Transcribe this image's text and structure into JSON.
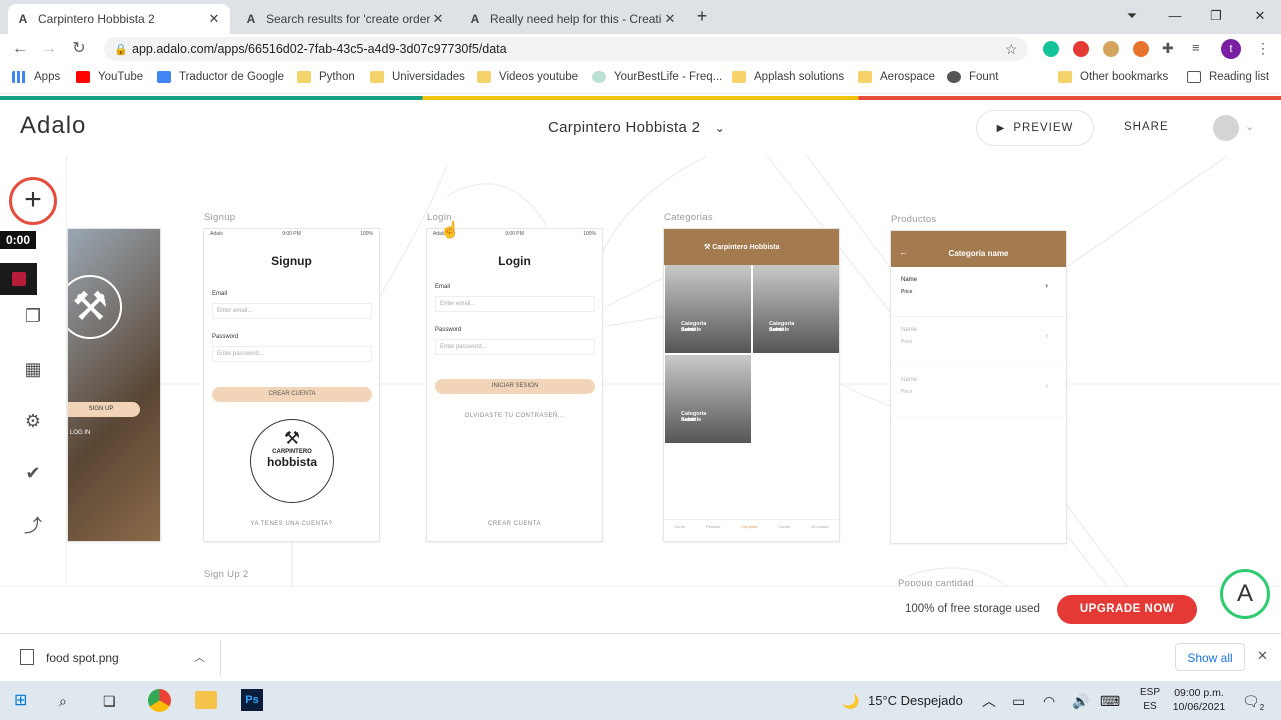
{
  "tabs": [
    {
      "title": "Carpintero Hobbista 2",
      "active": true
    },
    {
      "title": "Search results for 'create order c",
      "active": false
    },
    {
      "title": "Really need help for this - Creatir",
      "active": false
    }
  ],
  "address": {
    "url": "app.adalo.com/apps/66516d02-7fab-43c5-a4d9-3d07c97730f5/data"
  },
  "bookmarks": [
    "Apps",
    "YouTube",
    "Traductor de Google",
    "Python",
    "Universidades",
    "Videos youtube",
    "YourBestLife - Freq...",
    "Applash solutions",
    "Aerospace",
    "Fount",
    "Other bookmarks",
    "Reading list"
  ],
  "header": {
    "logo": "Adalo",
    "app_title": "Carpintero Hobbista 2",
    "preview": "PREVIEW",
    "share": "SHARE"
  },
  "sidebar": {
    "timer": "0:00"
  },
  "screens": {
    "signup": {
      "label": "Signup",
      "title": "Signup",
      "email_label": "Email",
      "email_ph": "Enter email...",
      "password_label": "Password",
      "password_ph": "Enter password...",
      "button": "CREAR CUENTA",
      "logo_top": "CARPINTERO",
      "logo_bottom": "hobbista",
      "link": "YA TENES UNA CUENTA?"
    },
    "login": {
      "label": "Login",
      "title": "Login",
      "email_label": "Email",
      "email_ph": "Enter email...",
      "password_label": "Password",
      "password_ph": "Enter password...",
      "button": "INICIAR SESION",
      "forgot": "OLVIDASTE TU CONTRASEÑ...",
      "link": "CREAR CUENTA"
    },
    "categorias": {
      "label": "Categorias",
      "header": "Carpintero Hobbista",
      "cards": [
        "Categoria name",
        "Categoria name",
        "Categoria name"
      ],
      "card_sub": "Subtitle",
      "nav": [
        "Home",
        "Pedidos",
        "Compras",
        "Carrito",
        "Mi cuenta"
      ]
    },
    "productos": {
      "label": "Productos",
      "header": "Categoria name",
      "rows": [
        {
          "name": "Name",
          "price": "Price"
        },
        {
          "name": "Name",
          "price": "Price"
        },
        {
          "name": "Name",
          "price": "Price"
        }
      ]
    },
    "welcome": {
      "signup": "SIGN UP",
      "login": "LOG IN"
    },
    "status_time": "9:00 PM",
    "status_battery": "100%",
    "status_carrier": "Adalo",
    "extra_labels": [
      "Sign Up 2",
      "Popoup cantidad"
    ]
  },
  "storage": {
    "text": "100% of free storage used",
    "button": "UPGRADE NOW"
  },
  "download": {
    "file": "food spot.png",
    "show_all": "Show all"
  },
  "taskbar": {
    "weather": "15°C  Despejado",
    "lang1": "ESP",
    "lang2": "ES",
    "time": "09:00 p.m.",
    "date": "10/06/2021",
    "notif": "2"
  }
}
